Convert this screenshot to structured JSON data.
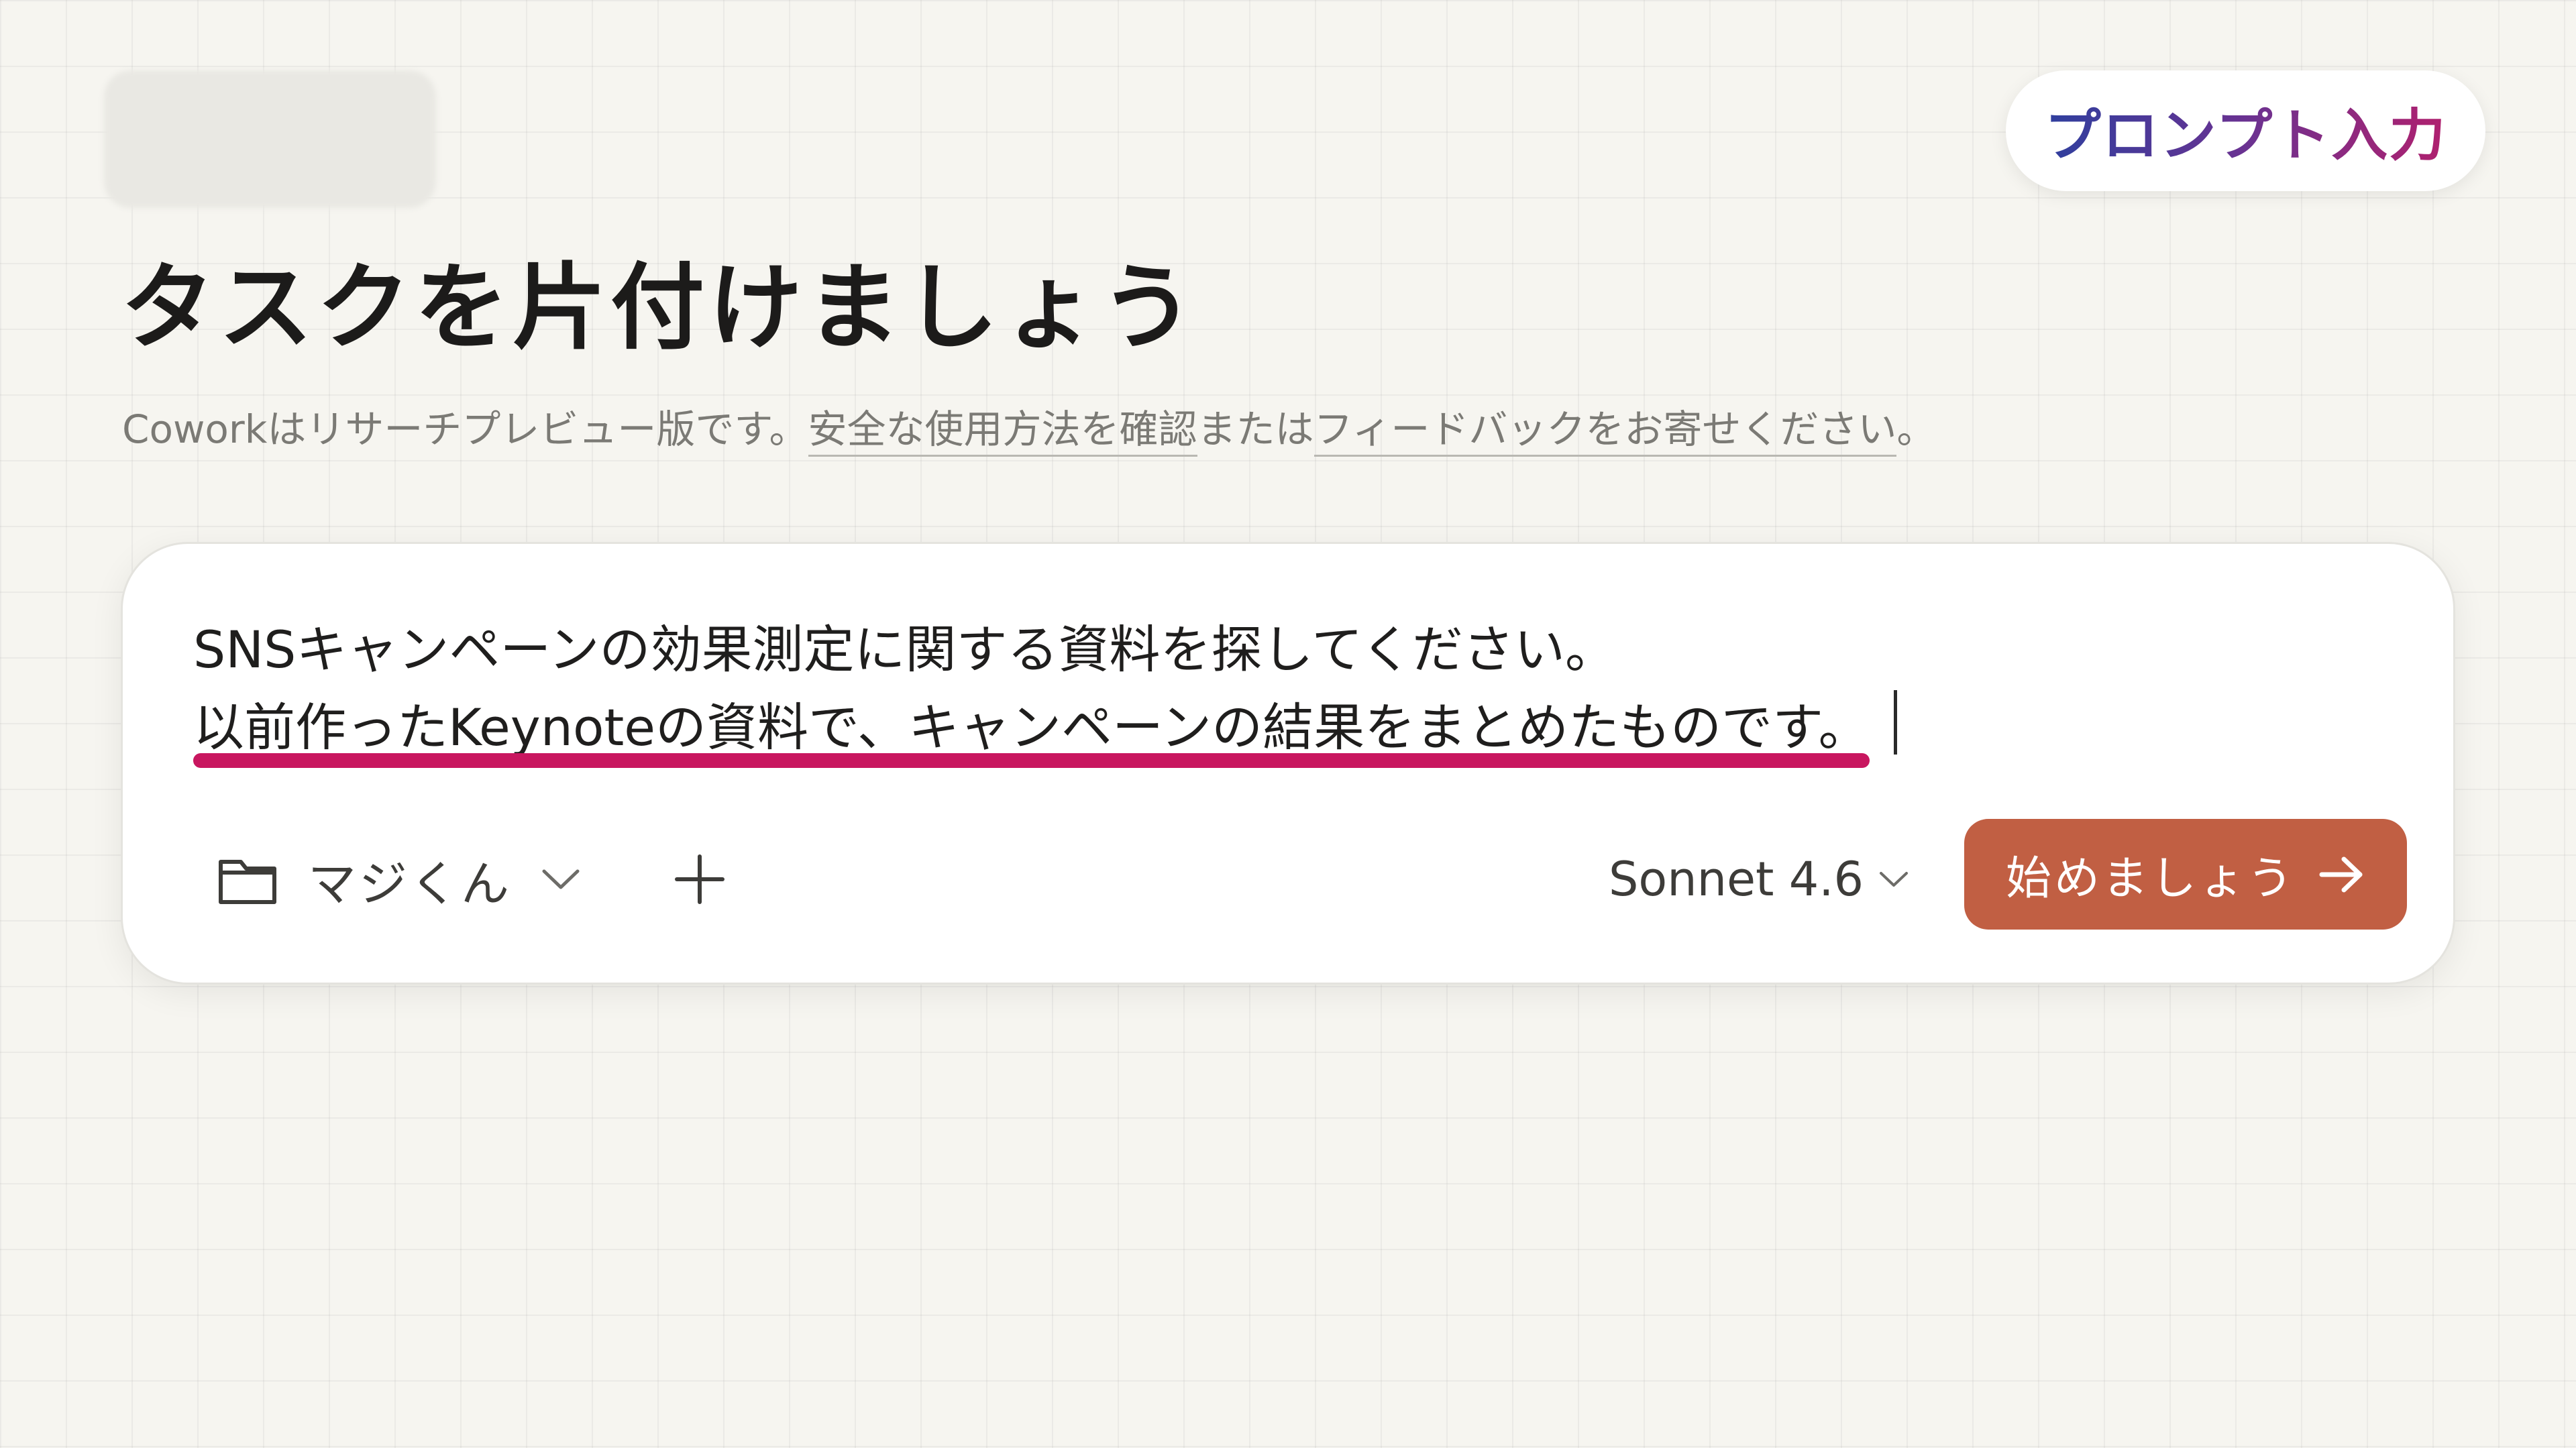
{
  "badge": {
    "label": "プロンプト入力",
    "gradient_colors": [
      "#2f3f9e",
      "#6a3291",
      "#b0206e"
    ]
  },
  "header": {
    "title": "タスクを片付けましょう",
    "subtitle": {
      "prefix": "Coworkはリサーチプレビュー版です。",
      "link_safety": "安全な使用方法を確認",
      "middle": "または",
      "link_feedback": "フィードバックをお寄せください",
      "suffix": "。"
    }
  },
  "composer": {
    "line1": "SNSキャンペーンの効果測定に関する資料を探してください。",
    "line2": "以前作ったKeynoteの資料で、キャンペーンの結果をまとめたものです。",
    "highlight_color": "#c8165f",
    "folder": {
      "icon": "folder-icon",
      "label": "マジくん",
      "chevron": "chevron-down-icon"
    },
    "add": {
      "icon": "plus-icon"
    },
    "model": {
      "label": "Sonnet 4.6",
      "chevron": "chevron-down-icon"
    },
    "start_button": {
      "label": "始めましょう",
      "icon": "arrow-right-icon",
      "color": "#c15f43"
    }
  }
}
